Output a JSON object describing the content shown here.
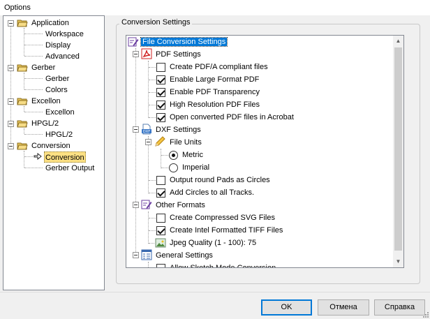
{
  "window": {
    "title": "Options"
  },
  "nav_tree": {
    "nodes": [
      {
        "label": "Application"
      },
      {
        "label": "Workspace"
      },
      {
        "label": "Display"
      },
      {
        "label": "Advanced"
      },
      {
        "label": "Gerber"
      },
      {
        "label": "Gerber"
      },
      {
        "label": "Colors"
      },
      {
        "label": "Excellon"
      },
      {
        "label": "Excellon"
      },
      {
        "label": "HPGL/2"
      },
      {
        "label": "HPGL/2"
      },
      {
        "label": "Conversion"
      },
      {
        "label": "Conversion"
      },
      {
        "label": "Gerber Output"
      }
    ]
  },
  "settings": {
    "group_title": "Conversion Settings",
    "root_label": "File Conversion Settings",
    "pdf": {
      "title": "PDF Settings",
      "options": [
        {
          "label": "Create PDF/A compliant files",
          "checked": false
        },
        {
          "label": "Enable Large Format PDF",
          "checked": true
        },
        {
          "label": "Enable PDF Transparency",
          "checked": true
        },
        {
          "label": "High Resolution PDF Files",
          "checked": true
        },
        {
          "label": "Open converted PDF files in Acrobat",
          "checked": true
        }
      ]
    },
    "dxf": {
      "title": "DXF Settings",
      "file_units_title": "File Units",
      "units": [
        {
          "label": "Metric",
          "selected": true
        },
        {
          "label": "Imperial",
          "selected": false
        }
      ],
      "options": [
        {
          "label": "Output round Pads as Circles",
          "checked": false
        },
        {
          "label": "Add Circles to all Tracks.",
          "checked": true
        }
      ]
    },
    "other": {
      "title": "Other Formats",
      "options": [
        {
          "label": "Create Compressed SVG Files",
          "checked": false
        },
        {
          "label": "Create Intel Formatted TIFF Files",
          "checked": true
        }
      ],
      "jpeg_quality_label": "Jpeg Quality (1 - 100): 75"
    },
    "general": {
      "title": "General Settings",
      "options": [
        {
          "label": "Allow Sketch Mode Conversion",
          "checked": false
        }
      ]
    }
  },
  "buttons": {
    "ok": "OK",
    "cancel": "Отмена",
    "help": "Справка"
  }
}
